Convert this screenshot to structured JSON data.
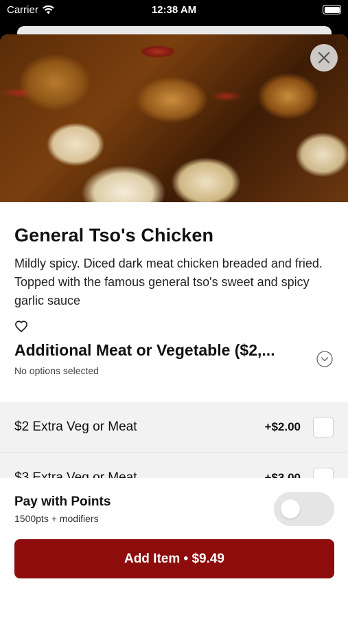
{
  "status_bar": {
    "carrier": "Carrier",
    "time": "12:38 AM",
    "icons": [
      "wifi-icon",
      "battery-icon"
    ]
  },
  "item": {
    "title": "General Tso's Chicken",
    "description": "Mildly spicy. Diced dark meat chicken breaded and fried. Topped with the famous general tso's sweet and spicy garlic sauce",
    "icons": [
      "close-icon",
      "heart-icon"
    ]
  },
  "modifier_group": {
    "title": "Additional Meat or Vegetable ($2,...",
    "subtitle": "No options selected",
    "options": [
      {
        "label": "$2 Extra Veg or Meat",
        "price": "+$2.00"
      },
      {
        "label": "$3 Extra Veg or Meat",
        "price": "+$3.00"
      }
    ]
  },
  "points": {
    "title": "Pay with Points",
    "subtitle": "1500pts + modifiers",
    "toggle_on": false
  },
  "add_button": {
    "label": "Add Item • $9.49"
  },
  "colors": {
    "accent": "#8d0d0d",
    "toggle_off": "#e5e5e5",
    "options_bg": "#f2f2f2"
  }
}
